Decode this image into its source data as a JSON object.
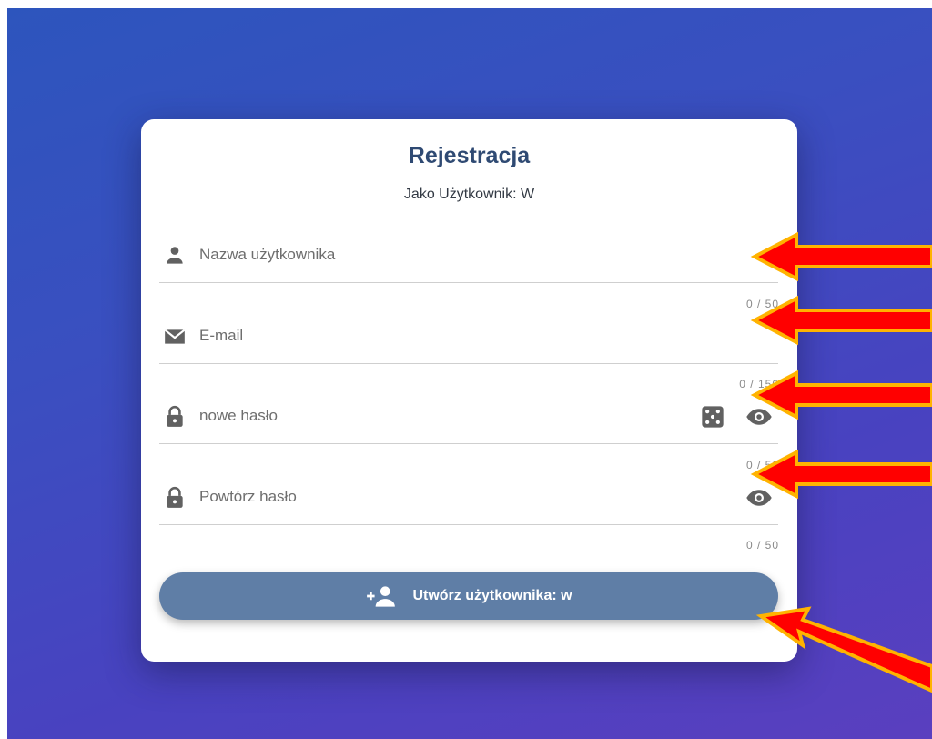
{
  "form": {
    "title": "Rejestracja",
    "subtitle": "Jako Użytkownik: W",
    "fields": {
      "username": {
        "placeholder": "Nazwa użytkownika",
        "counter": "0 / 50",
        "icon": "person-icon"
      },
      "email": {
        "placeholder": "E-mail",
        "counter": "0 / 150",
        "icon": "envelope-icon"
      },
      "new_password": {
        "placeholder": "nowe hasło",
        "counter": "0 / 50",
        "icon": "lock-icon",
        "actions": [
          "dice-icon",
          "eye-icon"
        ]
      },
      "repeat_password": {
        "placeholder": "Powtórz hasło",
        "counter": "0 / 50",
        "icon": "lock-icon",
        "actions": [
          "eye-icon"
        ]
      }
    },
    "submit_label": "Utwórz użytkownika: w",
    "submit_icon": "person-add-icon"
  },
  "colors": {
    "background_start": "#2d55bd",
    "background_end": "#5a3fbf",
    "title": "#2f4a73",
    "button": "#5f7ea6",
    "annotation_arrow_fill": "#ff0000",
    "annotation_arrow_outline": "#ffb300"
  }
}
